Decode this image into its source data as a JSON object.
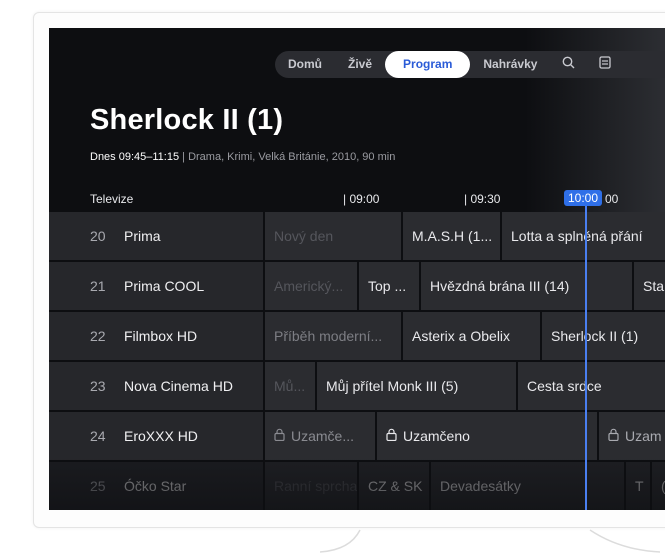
{
  "nav": {
    "items": [
      "Domů",
      "Živě",
      "Program",
      "Nahrávky"
    ],
    "active": "Program",
    "icons": [
      "search-icon",
      "guide-icon"
    ]
  },
  "hero": {
    "title": "Sherlock II (1)",
    "time": "Dnes 09:45–11:15",
    "details": " | Drama, Krimi, Velká Británie, 2010, 90 min"
  },
  "timeline": {
    "label": "Televize",
    "ticks": [
      "| 09:00",
      "| 09:30",
      "10:00",
      "00"
    ],
    "now": "10:00"
  },
  "channels": [
    {
      "num": "20",
      "name": "Prima"
    },
    {
      "num": "21",
      "name": "Prima COOL"
    },
    {
      "num": "22",
      "name": "Filmbox HD"
    },
    {
      "num": "23",
      "name": "Nova Cinema HD"
    },
    {
      "num": "24",
      "name": "EroXXX HD"
    },
    {
      "num": "25",
      "name": "Óčko Star"
    }
  ],
  "programs": {
    "r0": [
      "Nový den",
      "M.A.S.H (1...",
      "Lotta a splněná přání"
    ],
    "r1": [
      "Americký...",
      "Top ...",
      "Hvězdná brána III (14)",
      "Sta"
    ],
    "r2": [
      "Příběh moderní...",
      "Asterix a Obelix",
      "Sherlock II (1)"
    ],
    "r3": [
      "Mů...",
      "Můj přítel Monk III (5)",
      "Cesta srdce"
    ],
    "r4": [
      "Uzamče...",
      "Uzamčeno",
      "Uzam"
    ],
    "r5": [
      "Ranní sprcha",
      "CZ & SK",
      "Devadesátky",
      "T",
      "("
    ]
  }
}
